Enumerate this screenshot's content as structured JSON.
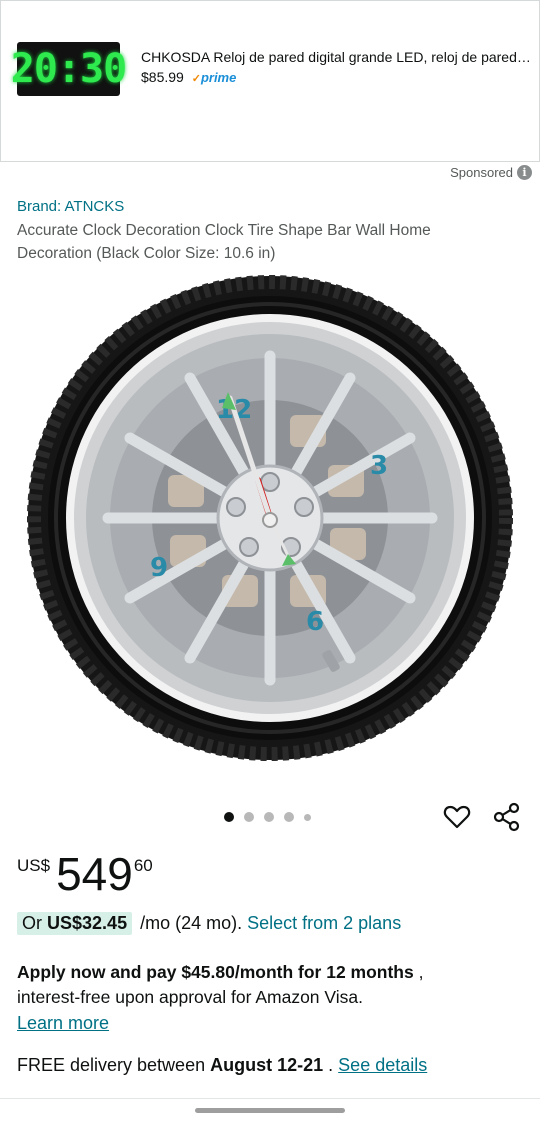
{
  "ad": {
    "thumb_text": "20:30",
    "title": "CHKOSDA Reloj de pared digital grande LED, reloj de pared de…",
    "price": "$85.99",
    "prime_label": "prime",
    "sponsored_label": "Sponsored",
    "info_glyph": "i",
    "thumb_color": "#2eea4f"
  },
  "product": {
    "brand": "Brand: ATNCKS",
    "title": "Accurate Clock Decoration Clock Tire Shape Bar Wall Home Decoration (Black Color Size: 10.6 in)",
    "image_dots": {
      "total": 5,
      "active": 1
    },
    "clock_numbers": [
      "12",
      "3",
      "6",
      "9"
    ]
  },
  "price": {
    "currency": "US$",
    "whole": "549",
    "fraction": "60"
  },
  "financing": {
    "prefix": "Or",
    "amount": "US$32.45",
    "terms": "/mo (24 mo).",
    "plans_link": "Select from 2 plans"
  },
  "visa_offer": {
    "bold_text": "Apply now and pay $45.80/month for 12 months",
    "comma": " ,",
    "line2": "interest-free upon approval for Amazon Visa.",
    "learn_more": "Learn more"
  },
  "delivery": {
    "prefix": "FREE delivery between",
    "dates": "August 12-21",
    "separator": " .",
    "details_link": "See details"
  },
  "colors": {
    "link": "#007185",
    "badge_bg": "#d7f0e7",
    "prime": "#1a8fd8"
  }
}
